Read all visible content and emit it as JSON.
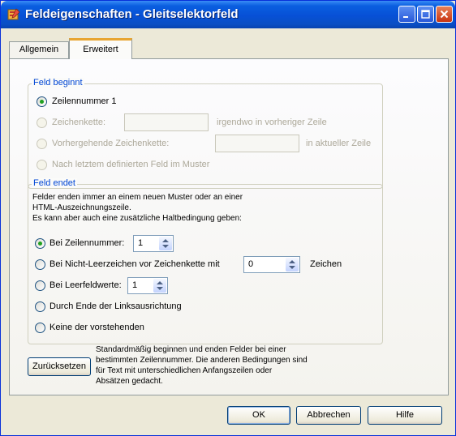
{
  "window": {
    "title": "Feldeigenschaften - Gleitselektorfeld",
    "icon": "app-icon"
  },
  "tabs": [
    {
      "label": "Allgemein",
      "active": false
    },
    {
      "label": "Erweitert",
      "active": true
    }
  ],
  "feld_beginnt": {
    "legend": "Feld beginnt",
    "options": [
      {
        "label": "Zeilennummer 1",
        "selected": true,
        "enabled": true
      },
      {
        "label": "Zeichenkette:",
        "suffix": "irgendwo in vorheriger Zeile",
        "value": "",
        "selected": false,
        "enabled": false
      },
      {
        "label": "Vorhergehende Zeichenkette:",
        "suffix": "in aktueller Zeile",
        "value": "",
        "selected": false,
        "enabled": false
      },
      {
        "label": "Nach letztem definierten Feld im Muster",
        "selected": false,
        "enabled": false
      }
    ]
  },
  "feld_endet": {
    "legend": "Feld endet",
    "description_lines": [
      "Felder enden immer an einem neuen Muster oder an einer",
      "HTML-Auszeichnungszeile.",
      "Es kann aber auch eine zusätzliche Haltbedingung geben:"
    ],
    "options": [
      {
        "label": "Bei Zeilennummer:",
        "value": "1",
        "selected": true
      },
      {
        "label": "Bei Nicht-Leerzeichen vor Zeichenkette mit",
        "value": "0",
        "suffix": "Zeichen",
        "selected": false
      },
      {
        "label": "Bei Leerfeldwerte:",
        "value": "1",
        "selected": false
      },
      {
        "label": "Durch Ende der Linksausrichtung",
        "selected": false
      },
      {
        "label": "Keine der vorstehenden",
        "selected": false
      }
    ]
  },
  "reset": {
    "button_label": "Zurücksetzen",
    "info_lines": [
      "Standardmäßig beginnen und enden Felder bei einer",
      "bestimmten Zeilennummer. Die anderen Bedingungen sind",
      "für Text mit unterschiedlichen Anfangszeilen oder",
      "Absätzen gedacht."
    ]
  },
  "footer": {
    "ok_label": "OK",
    "cancel_label": "Abbrechen",
    "help_label": "Hilfe"
  },
  "colors": {
    "titlebar": "#0a5fe0",
    "legend_text": "#0046d5",
    "active_tab_accent": "#e8a531",
    "radio_dot": "#21a121"
  }
}
